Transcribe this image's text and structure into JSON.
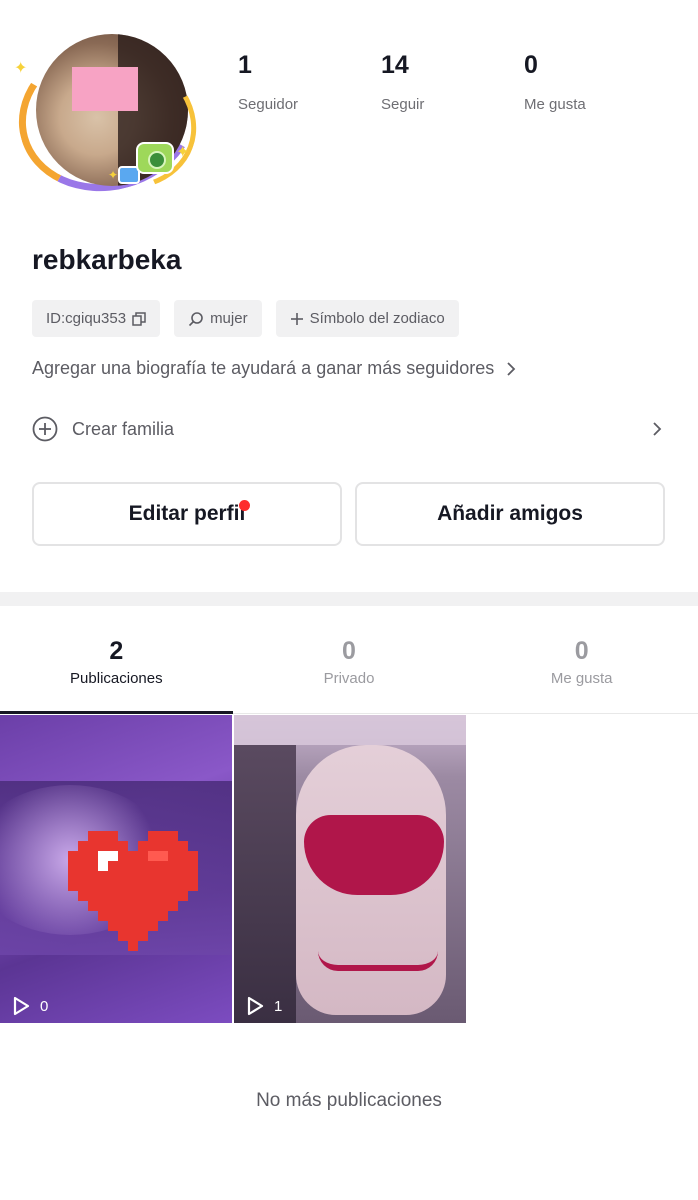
{
  "profile": {
    "username": "rebkarbeka",
    "stats": [
      {
        "count": "1",
        "label": "Seguidor"
      },
      {
        "count": "14",
        "label": "Seguir"
      },
      {
        "count": "0",
        "label": "Me gusta"
      }
    ],
    "chips": {
      "id": "ID:cgiqu353",
      "gender": "mujer",
      "zodiac": "Símbolo del zodiaco"
    },
    "bio_prompt": "Agregar una biografía te ayudará a ganar más seguidores",
    "family_label": "Crear familia",
    "buttons": {
      "edit": "Editar perfil",
      "add_friends": "Añadir amigos"
    }
  },
  "tabs": [
    {
      "count": "2",
      "label": "Publicaciones",
      "active": true
    },
    {
      "count": "0",
      "label": "Privado",
      "active": false
    },
    {
      "count": "0",
      "label": "Me gusta",
      "active": false
    }
  ],
  "posts": [
    {
      "plays": "0"
    },
    {
      "plays": "1"
    }
  ],
  "footer": {
    "no_more": "No más publicaciones"
  },
  "icons": {
    "copy": "copy-icon",
    "search": "search-icon",
    "plus": "plus-icon",
    "chevron": "chevron-right-icon",
    "add_circle": "add-circle-icon",
    "play": "play-icon"
  },
  "colors": {
    "accent_red": "#fe2c2c",
    "text_primary": "#161823",
    "text_secondary": "#5c5c63"
  }
}
